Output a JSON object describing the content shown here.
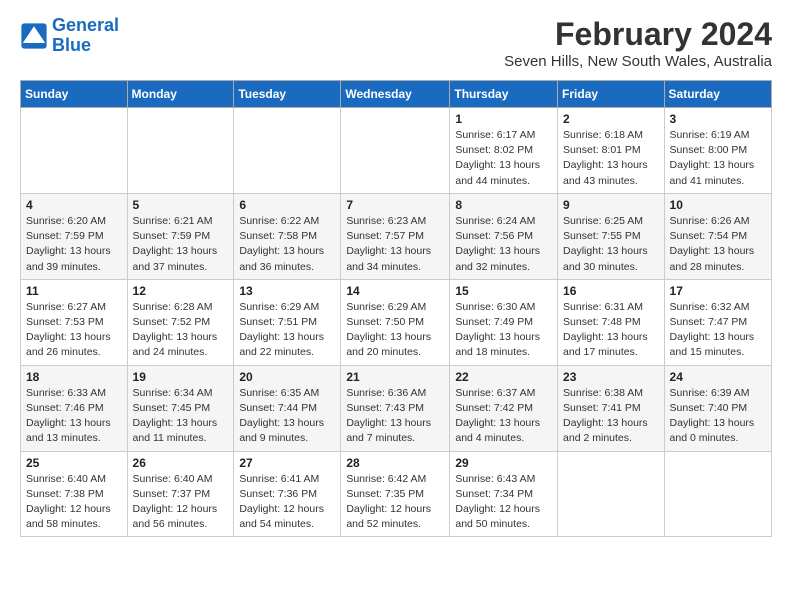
{
  "logo": {
    "line1": "General",
    "line2": "Blue"
  },
  "title": "February 2024",
  "subtitle": "Seven Hills, New South Wales, Australia",
  "days_of_week": [
    "Sunday",
    "Monday",
    "Tuesday",
    "Wednesday",
    "Thursday",
    "Friday",
    "Saturday"
  ],
  "weeks": [
    [
      {
        "day": "",
        "info": ""
      },
      {
        "day": "",
        "info": ""
      },
      {
        "day": "",
        "info": ""
      },
      {
        "day": "",
        "info": ""
      },
      {
        "day": "1",
        "info": "Sunrise: 6:17 AM\nSunset: 8:02 PM\nDaylight: 13 hours\nand 44 minutes."
      },
      {
        "day": "2",
        "info": "Sunrise: 6:18 AM\nSunset: 8:01 PM\nDaylight: 13 hours\nand 43 minutes."
      },
      {
        "day": "3",
        "info": "Sunrise: 6:19 AM\nSunset: 8:00 PM\nDaylight: 13 hours\nand 41 minutes."
      }
    ],
    [
      {
        "day": "4",
        "info": "Sunrise: 6:20 AM\nSunset: 7:59 PM\nDaylight: 13 hours\nand 39 minutes."
      },
      {
        "day": "5",
        "info": "Sunrise: 6:21 AM\nSunset: 7:59 PM\nDaylight: 13 hours\nand 37 minutes."
      },
      {
        "day": "6",
        "info": "Sunrise: 6:22 AM\nSunset: 7:58 PM\nDaylight: 13 hours\nand 36 minutes."
      },
      {
        "day": "7",
        "info": "Sunrise: 6:23 AM\nSunset: 7:57 PM\nDaylight: 13 hours\nand 34 minutes."
      },
      {
        "day": "8",
        "info": "Sunrise: 6:24 AM\nSunset: 7:56 PM\nDaylight: 13 hours\nand 32 minutes."
      },
      {
        "day": "9",
        "info": "Sunrise: 6:25 AM\nSunset: 7:55 PM\nDaylight: 13 hours\nand 30 minutes."
      },
      {
        "day": "10",
        "info": "Sunrise: 6:26 AM\nSunset: 7:54 PM\nDaylight: 13 hours\nand 28 minutes."
      }
    ],
    [
      {
        "day": "11",
        "info": "Sunrise: 6:27 AM\nSunset: 7:53 PM\nDaylight: 13 hours\nand 26 minutes."
      },
      {
        "day": "12",
        "info": "Sunrise: 6:28 AM\nSunset: 7:52 PM\nDaylight: 13 hours\nand 24 minutes."
      },
      {
        "day": "13",
        "info": "Sunrise: 6:29 AM\nSunset: 7:51 PM\nDaylight: 13 hours\nand 22 minutes."
      },
      {
        "day": "14",
        "info": "Sunrise: 6:29 AM\nSunset: 7:50 PM\nDaylight: 13 hours\nand 20 minutes."
      },
      {
        "day": "15",
        "info": "Sunrise: 6:30 AM\nSunset: 7:49 PM\nDaylight: 13 hours\nand 18 minutes."
      },
      {
        "day": "16",
        "info": "Sunrise: 6:31 AM\nSunset: 7:48 PM\nDaylight: 13 hours\nand 17 minutes."
      },
      {
        "day": "17",
        "info": "Sunrise: 6:32 AM\nSunset: 7:47 PM\nDaylight: 13 hours\nand 15 minutes."
      }
    ],
    [
      {
        "day": "18",
        "info": "Sunrise: 6:33 AM\nSunset: 7:46 PM\nDaylight: 13 hours\nand 13 minutes."
      },
      {
        "day": "19",
        "info": "Sunrise: 6:34 AM\nSunset: 7:45 PM\nDaylight: 13 hours\nand 11 minutes."
      },
      {
        "day": "20",
        "info": "Sunrise: 6:35 AM\nSunset: 7:44 PM\nDaylight: 13 hours\nand 9 minutes."
      },
      {
        "day": "21",
        "info": "Sunrise: 6:36 AM\nSunset: 7:43 PM\nDaylight: 13 hours\nand 7 minutes."
      },
      {
        "day": "22",
        "info": "Sunrise: 6:37 AM\nSunset: 7:42 PM\nDaylight: 13 hours\nand 4 minutes."
      },
      {
        "day": "23",
        "info": "Sunrise: 6:38 AM\nSunset: 7:41 PM\nDaylight: 13 hours\nand 2 minutes."
      },
      {
        "day": "24",
        "info": "Sunrise: 6:39 AM\nSunset: 7:40 PM\nDaylight: 13 hours\nand 0 minutes."
      }
    ],
    [
      {
        "day": "25",
        "info": "Sunrise: 6:40 AM\nSunset: 7:38 PM\nDaylight: 12 hours\nand 58 minutes."
      },
      {
        "day": "26",
        "info": "Sunrise: 6:40 AM\nSunset: 7:37 PM\nDaylight: 12 hours\nand 56 minutes."
      },
      {
        "day": "27",
        "info": "Sunrise: 6:41 AM\nSunset: 7:36 PM\nDaylight: 12 hours\nand 54 minutes."
      },
      {
        "day": "28",
        "info": "Sunrise: 6:42 AM\nSunset: 7:35 PM\nDaylight: 12 hours\nand 52 minutes."
      },
      {
        "day": "29",
        "info": "Sunrise: 6:43 AM\nSunset: 7:34 PM\nDaylight: 12 hours\nand 50 minutes."
      },
      {
        "day": "",
        "info": ""
      },
      {
        "day": "",
        "info": ""
      }
    ]
  ]
}
